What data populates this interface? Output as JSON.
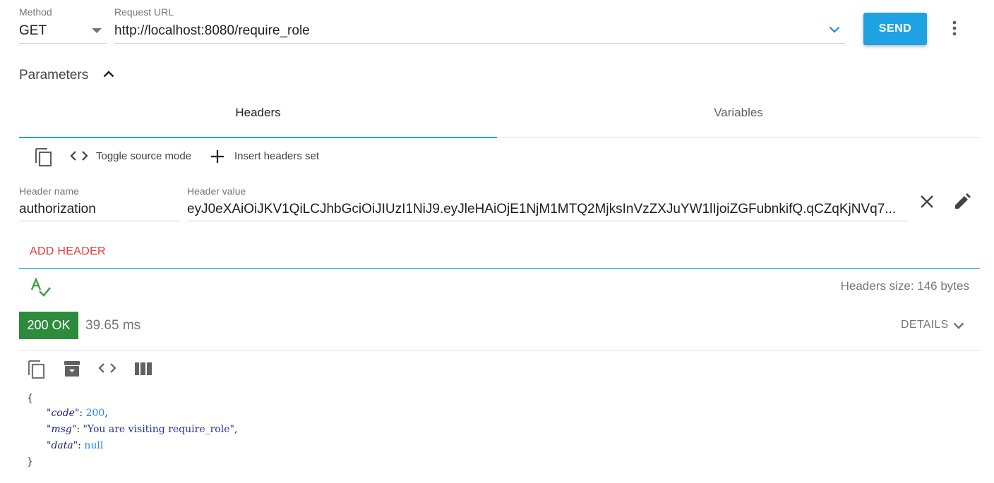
{
  "request": {
    "method_label": "Method",
    "method_value": "GET",
    "url_label": "Request URL",
    "url_value": "http://localhost:8080/require_role",
    "send_label": "SEND"
  },
  "parameters": {
    "title": "Parameters",
    "tabs": [
      {
        "label": "Headers",
        "active": true
      },
      {
        "label": "Variables",
        "active": false
      }
    ]
  },
  "headers_toolbar": {
    "toggle_source_label": "Toggle source mode",
    "insert_set_label": "Insert headers set"
  },
  "header_row": {
    "name_label": "Header name",
    "name_value": "authorization",
    "value_label": "Header value",
    "value_value": "eyJ0eXAiOiJKV1QiLCJhbGciOiJIUzI1NiJ9.eyJleHAiOjE1NjM1MTQ2MjksInVzZXJuYW1lIjoiZGFubnkifQ.qCZqKjNVq7..."
  },
  "add_header_label": "ADD HEADER",
  "headers_size_label": "Headers size: 146 bytes",
  "response": {
    "status": "200 OK",
    "time": "39.65 ms",
    "details_label": "DETAILS",
    "json": {
      "open": "{",
      "close": "}",
      "code_key": "\"code\"",
      "code_val": "200",
      "msg_key": "\"msg\"",
      "msg_val": "\"You are visiting require_role\"",
      "data_key": "\"data\"",
      "data_val": "null"
    }
  },
  "colors": {
    "accent": "#1ea2e1",
    "status_ok": "#2e8b3e",
    "add_header": "#e53935",
    "spell_icon": "#43a047"
  }
}
